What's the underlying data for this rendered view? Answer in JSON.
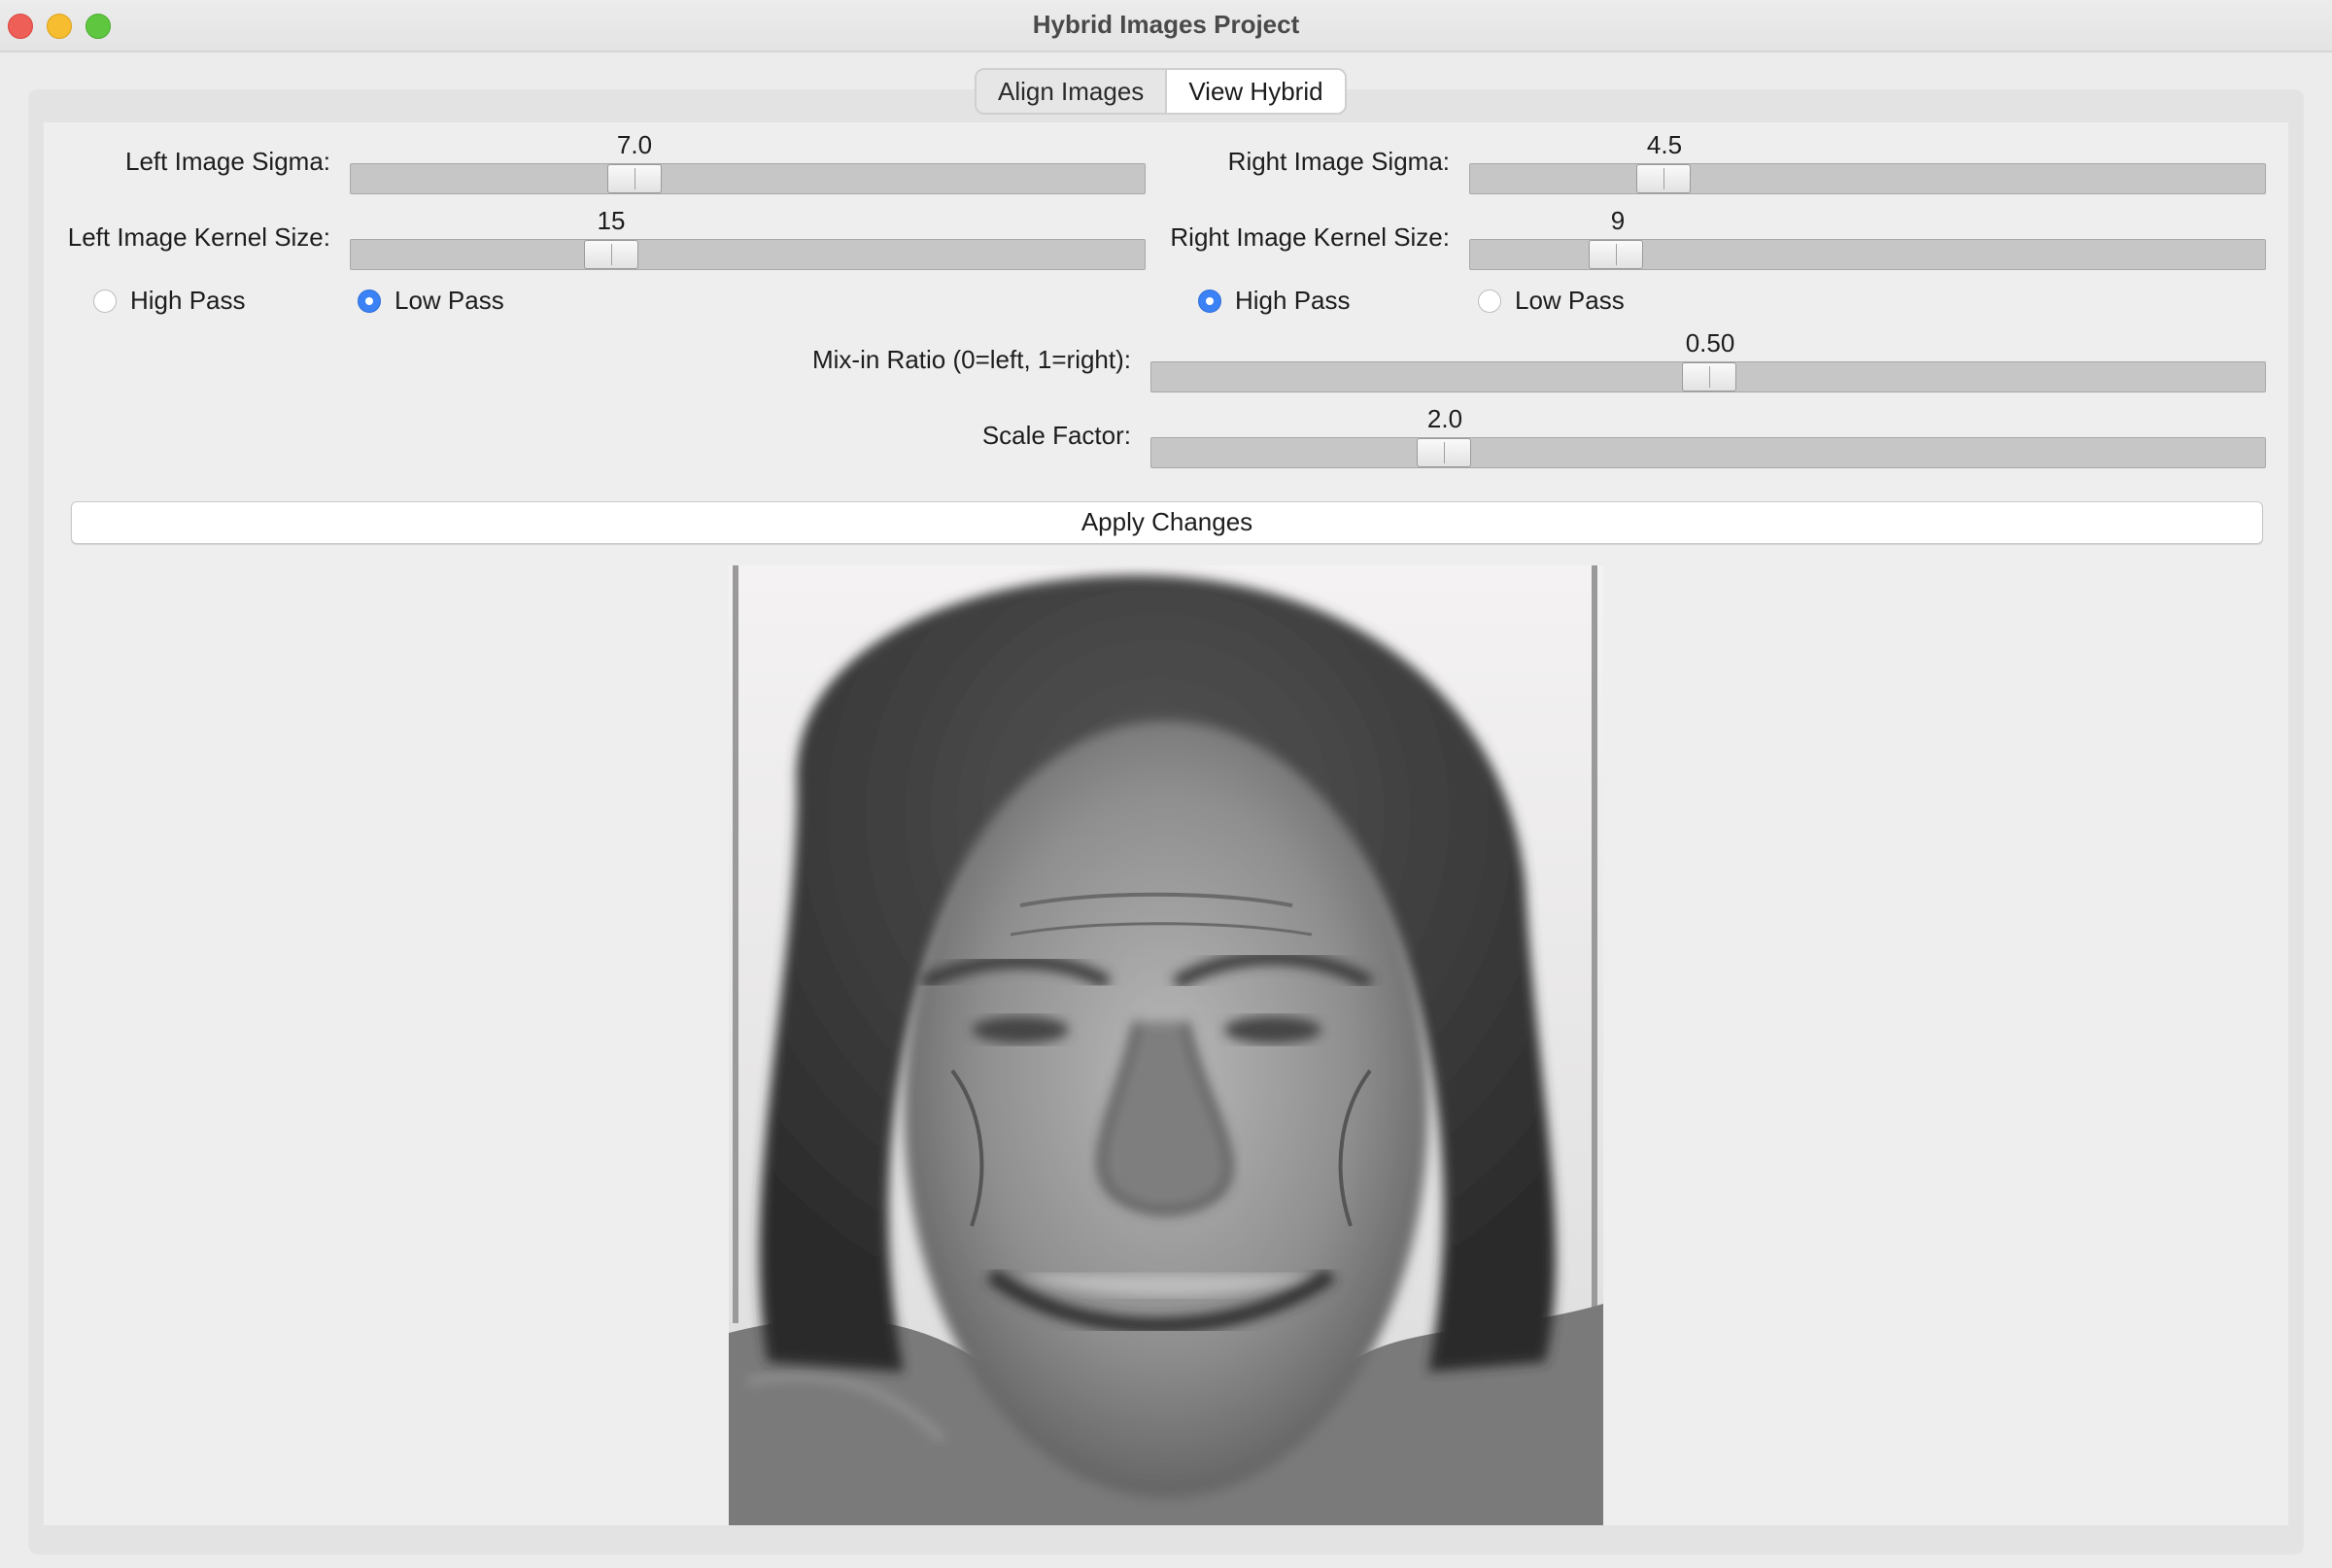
{
  "window": {
    "title": "Hybrid Images Project"
  },
  "tabs": [
    {
      "label": "Align Images",
      "active": false
    },
    {
      "label": "View Hybrid",
      "active": true
    }
  ],
  "left": {
    "sigma_label": "Left Image Sigma:",
    "sigma_value": "7.0",
    "kernel_label": "Left Image Kernel Size:",
    "kernel_value": "15",
    "filter_options": [
      "High Pass",
      "Low Pass"
    ],
    "filter_selected": "Low Pass"
  },
  "right": {
    "sigma_label": "Right Image Sigma:",
    "sigma_value": "4.5",
    "kernel_label": "Right Image Kernel Size:",
    "kernel_value": "9",
    "filter_options": [
      "High Pass",
      "Low Pass"
    ],
    "filter_selected": "High Pass"
  },
  "mix": {
    "label": "Mix-in Ratio (0=left, 1=right):",
    "value": "0.50"
  },
  "scale": {
    "label": "Scale Factor:",
    "value": "2.0"
  },
  "apply_label": "Apply Changes",
  "colors": {
    "accent": "#3b82f6",
    "track": "#c6c6c6",
    "background": "#ececec"
  },
  "image": {
    "content": "grayscale hybrid face image"
  }
}
